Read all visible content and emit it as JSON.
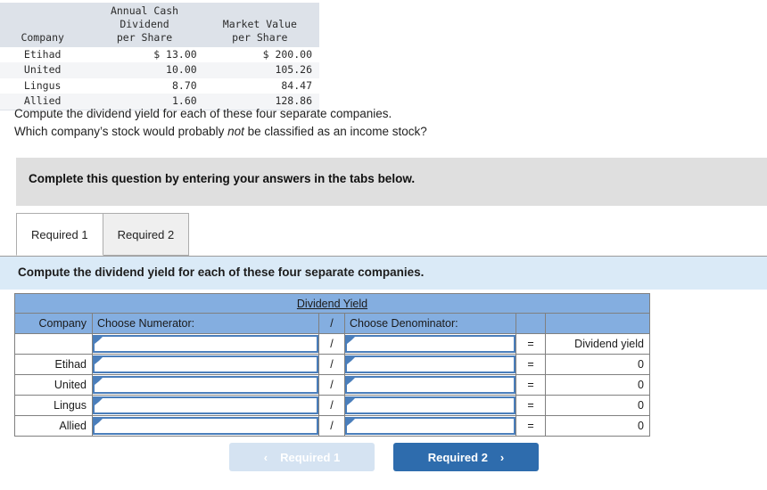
{
  "data_table": {
    "headers": {
      "company": "Company",
      "dividend_line1": "Annual Cash Dividend",
      "dividend_line2": "per Share",
      "market_line1": "Market Value",
      "market_line2": "per Share"
    },
    "rows": [
      {
        "company": "Etihad",
        "dividend": "$ 13.00",
        "market": "$ 200.00"
      },
      {
        "company": "United",
        "dividend": "10.00",
        "market": "105.26"
      },
      {
        "company": "Lingus",
        "dividend": "8.70",
        "market": "84.47"
      },
      {
        "company": "Allied",
        "dividend": "1.60",
        "market": "128.86"
      }
    ]
  },
  "question": {
    "line1": "Compute the dividend yield for each of these four separate companies.",
    "line2_pre": "Which company’s stock would probably ",
    "line2_em": "not",
    "line2_post": " be classified as an income stock?"
  },
  "instruction_banner": {
    "text": "Complete this question by entering your answers in the tabs below."
  },
  "tabs": [
    {
      "label": "Required 1",
      "active": true
    },
    {
      "label": "Required 2",
      "active": false
    }
  ],
  "sub_instruction": {
    "text": "Compute the dividend yield for each of these four separate companies."
  },
  "answer_table": {
    "title": "Dividend Yield",
    "headers": {
      "company": "Company",
      "numerator": "Choose Numerator:",
      "slash": "/",
      "denominator": "Choose Denominator:",
      "equals": "",
      "result": ""
    },
    "label_row": {
      "company": "",
      "numerator": "",
      "slash": "/",
      "denominator": "",
      "equals": "=",
      "result": "Dividend yield"
    },
    "rows": [
      {
        "company": "Etihad",
        "numerator": "",
        "slash": "/",
        "denominator": "",
        "equals": "=",
        "result": "0"
      },
      {
        "company": "United",
        "numerator": "",
        "slash": "/",
        "denominator": "",
        "equals": "=",
        "result": "0"
      },
      {
        "company": "Lingus",
        "numerator": "",
        "slash": "/",
        "denominator": "",
        "equals": "=",
        "result": "0"
      },
      {
        "company": "Allied",
        "numerator": "",
        "slash": "/",
        "denominator": "",
        "equals": "=",
        "result": "0"
      }
    ]
  },
  "nav": {
    "prev_label": "Required 1",
    "prev_chevron": "‹",
    "next_label": "Required 2",
    "next_chevron": "›"
  },
  "colors": {
    "header_blue": "#84aee0",
    "sub_instruction_blue": "#daeaf7",
    "banner_gray": "#dfdfdf",
    "button_active_blue": "#2e6cad",
    "button_disabled_blue": "#d5e3f2",
    "cell_border_blue": "#4a7ebb"
  }
}
